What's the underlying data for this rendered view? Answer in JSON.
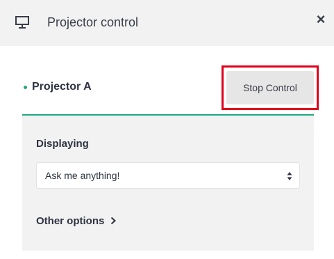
{
  "header": {
    "title": "Projector control",
    "close_label": "×"
  },
  "projector": {
    "name": "Projector A",
    "status_color": "#1fa884",
    "stop_label": "Stop Control"
  },
  "panel": {
    "displaying_label": "Displaying",
    "selected_display": "Ask me anything!",
    "other_options_label": "Other options"
  },
  "colors": {
    "accent": "#1fa884",
    "highlight": "#e0001b"
  }
}
